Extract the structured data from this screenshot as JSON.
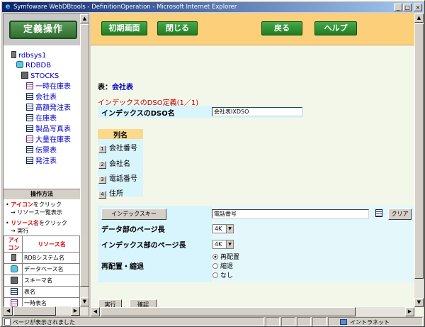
{
  "window": {
    "title": "Symfoware WebDBtools - DefinitionOperation - Microsoft Internet Explorer"
  },
  "left": {
    "header_button": "定義操作",
    "tree": {
      "root": "rdbsys1",
      "db": "RDBDB",
      "schema": "STOCKS",
      "tables": [
        "一時在庫表",
        "会社表",
        "高額発注表",
        "在庫表",
        "製品写真表",
        "大量在庫表",
        "伝票表",
        "発注表"
      ]
    },
    "howto": {
      "title": "操作方法",
      "line1_em": "アイコン",
      "line1_rest": "をクリック",
      "line1_result": "→ リソース一覧表示",
      "line2_em": "リソース名",
      "line2_rest": "をクリック",
      "line2_result": "→ 実行"
    },
    "legend": {
      "col_icon": "アイコン",
      "col_resource": "リソース名",
      "rows": [
        "RDBシステム名",
        "データベース名",
        "スキーマ名",
        "表名",
        "一時表名"
      ]
    }
  },
  "toolbar": {
    "home": "初期画面",
    "close": "閉じる",
    "back": "戻る",
    "help": "ヘルプ"
  },
  "content": {
    "table_label": "表：",
    "table_name": "会社表",
    "section_title": "インデックスのDSO定義(1／1)",
    "dso_label": "インデックスのDSO名",
    "dso_value": "会社表IXDSO",
    "columns_header": "列名",
    "columns": [
      "会社番号",
      "会社名",
      "電話番号",
      "住所"
    ],
    "index_key_button": "インデックスキー",
    "index_key_value": "電話番号",
    "clear_button": "クリア",
    "data_page_label": "データ部のページ長",
    "data_page_value": "4K",
    "index_page_label": "インデックス部のページ長",
    "index_page_value": "4K",
    "realloc_label": "再配置・縮退",
    "realloc_options": [
      "再配置",
      "縮退",
      "なし"
    ],
    "execute_button": "実行",
    "confirm_button": "確認"
  },
  "status": {
    "left": "ページが表示されました",
    "zone": "イントラネット"
  }
}
